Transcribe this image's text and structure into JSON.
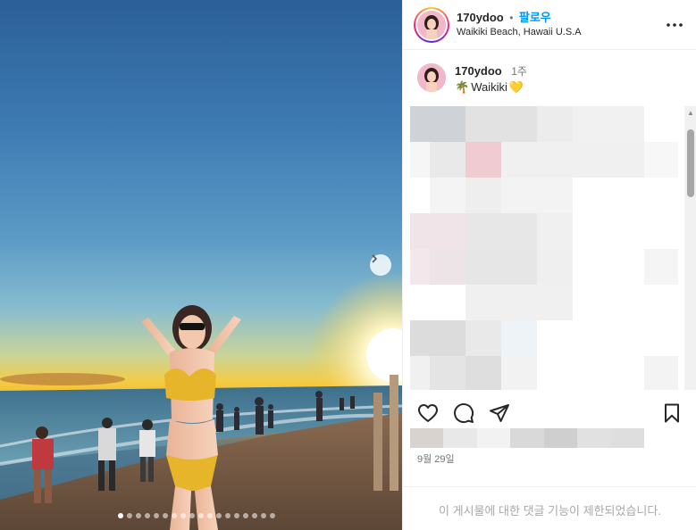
{
  "post": {
    "username": "170ydoo",
    "follow_label": "팔로우",
    "separator": "•",
    "location": "Waikiki Beach, Hawaii U.S.A",
    "more_icon": "more-options-icon"
  },
  "caption": {
    "username": "170ydoo",
    "time_ago": "1주",
    "text": "Waikiki",
    "emoji_before": "🌴",
    "emoji_after": "💛"
  },
  "actions": {
    "icons": [
      "heart-icon",
      "comment-icon",
      "share-icon",
      "bookmark-icon"
    ]
  },
  "meta": {
    "date": "9월 29일",
    "comments_restricted": "이 게시물에 대한 댓글 기능이 제한되었습니다."
  },
  "carousel": {
    "total_slides": 18,
    "current_slide": 1
  },
  "colors": {
    "follow": "#0095f6",
    "muted": "#737373",
    "restricted": "#a8a8a8"
  }
}
